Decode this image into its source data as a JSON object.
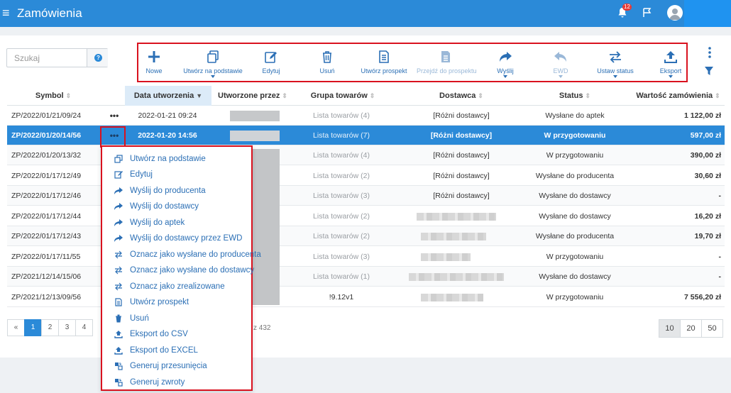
{
  "header": {
    "title": "Zamówienia",
    "notification_count": "12"
  },
  "search": {
    "placeholder": "Szukaj",
    "help": "?"
  },
  "toolbar": {
    "buttons": [
      {
        "label": "Nowe",
        "icon": "plus-icon",
        "caret": false,
        "disabled": false
      },
      {
        "label": "Utwórz na podstawie",
        "icon": "copy-icon",
        "caret": true,
        "disabled": false
      },
      {
        "label": "Edytuj",
        "icon": "edit-icon",
        "caret": false,
        "disabled": false
      },
      {
        "label": "Usuń",
        "icon": "trash-icon",
        "caret": false,
        "disabled": false
      },
      {
        "label": "Utwórz prospekt",
        "icon": "document-icon",
        "caret": false,
        "disabled": false
      },
      {
        "label": "Przejdź do prospektu",
        "icon": "document-filled-icon",
        "caret": false,
        "disabled": true
      },
      {
        "label": "Wyślij",
        "icon": "share-icon",
        "caret": true,
        "disabled": false
      },
      {
        "label": "EWD",
        "icon": "reply-icon",
        "caret": true,
        "disabled": true
      },
      {
        "label": "Ustaw status",
        "icon": "swap-icon",
        "caret": true,
        "disabled": false
      },
      {
        "label": "Eksport",
        "icon": "upload-icon",
        "caret": true,
        "disabled": false
      }
    ]
  },
  "table": {
    "columns": [
      "Symbol",
      "Data utworzenia",
      "Utworzone przez",
      "Grupa towarów",
      "Dostawca",
      "Status",
      "Wartość zamówienia"
    ],
    "row_action": "•••",
    "rows": [
      {
        "symbol": "ZP/2022/01/21/09/24",
        "date": "2022-01-21 09:24",
        "group": "Lista towarów (4)",
        "supplier": "[Różni dostawcy]",
        "status": "Wysłane do aptek",
        "value": "1 122,00 zł"
      },
      {
        "symbol": "ZP/2022/01/20/14/56",
        "date": "2022-01-20 14:56",
        "group": "Lista towarów (7)",
        "supplier": "[Różni dostawcy]",
        "status": "W przygotowaniu",
        "value": "597,00 zł"
      },
      {
        "symbol": "ZP/2022/01/20/13/32",
        "date": "",
        "group": "Lista towarów (4)",
        "supplier": "[Różni dostawcy]",
        "status": "W przygotowaniu",
        "value": "390,00 zł"
      },
      {
        "symbol": "ZP/2022/01/17/12/49",
        "date": "",
        "group": "Lista towarów (2)",
        "supplier": "[Różni dostawcy]",
        "status": "Wysłane do producenta",
        "value": "30,60 zł"
      },
      {
        "symbol": "ZP/2022/01/17/12/46",
        "date": "",
        "group": "Lista towarów (3)",
        "supplier": "[Różni dostawcy]",
        "status": "Wysłane do dostawcy",
        "value": "-"
      },
      {
        "symbol": "ZP/2022/01/17/12/44",
        "date": "",
        "group": "Lista towarów (2)",
        "supplier": "",
        "status": "Wysłane do dostawcy",
        "value": "16,20 zł"
      },
      {
        "symbol": "ZP/2022/01/17/12/43",
        "date": "",
        "group": "Lista towarów (2)",
        "supplier": "",
        "status": "Wysłane do producenta",
        "value": "19,70 zł"
      },
      {
        "symbol": "ZP/2022/01/17/11/55",
        "date": "",
        "group": "Lista towarów (3)",
        "supplier": "",
        "status": "W przygotowaniu",
        "value": "-"
      },
      {
        "symbol": "ZP/2021/12/14/15/06",
        "date": "",
        "group": "Lista towarów (1)",
        "supplier": "",
        "status": "Wysłane do dostawcy",
        "value": "-"
      },
      {
        "symbol": "ZP/2021/12/13/09/56",
        "date": "",
        "group": "!9.12v1",
        "supplier": "",
        "status": "W przygotowaniu",
        "value": "7 556,20 zł"
      }
    ]
  },
  "pagination": {
    "prev": "«",
    "pages": [
      "1",
      "2",
      "3",
      "4"
    ],
    "info": "z 432",
    "sizes": [
      "10",
      "20",
      "50"
    ]
  },
  "context_menu": {
    "items": [
      {
        "label": "Utwórz na podstawie",
        "icon": "copy-icon"
      },
      {
        "label": "Edytuj",
        "icon": "edit-icon"
      },
      {
        "label": "Wyślij do producenta",
        "icon": "share-icon"
      },
      {
        "label": "Wyślij do dostawcy",
        "icon": "share-icon"
      },
      {
        "label": "Wyślij do aptek",
        "icon": "share-icon"
      },
      {
        "label": "Wyślij do dostawcy przez EWD",
        "icon": "share-icon"
      },
      {
        "label": "Oznacz jako wysłane do producenta",
        "icon": "swap-icon"
      },
      {
        "label": "Oznacz jako wysłane do dostawcy",
        "icon": "swap-icon"
      },
      {
        "label": "Oznacz jako zrealizowane",
        "icon": "swap-icon"
      },
      {
        "label": "Utwórz prospekt",
        "icon": "document-icon"
      },
      {
        "label": "Usuń",
        "icon": "trash-icon"
      },
      {
        "label": "Eksport do CSV",
        "icon": "upload-icon"
      },
      {
        "label": "Eksport do EXCEL",
        "icon": "upload-icon"
      },
      {
        "label": "Generuj przesunięcia",
        "icon": "transfer-icon"
      },
      {
        "label": "Generuj zwroty",
        "icon": "transfer-icon"
      }
    ]
  },
  "colors": {
    "primary": "#2b8ad8",
    "highlight": "#d9121f",
    "link": "#2b6fb5"
  }
}
